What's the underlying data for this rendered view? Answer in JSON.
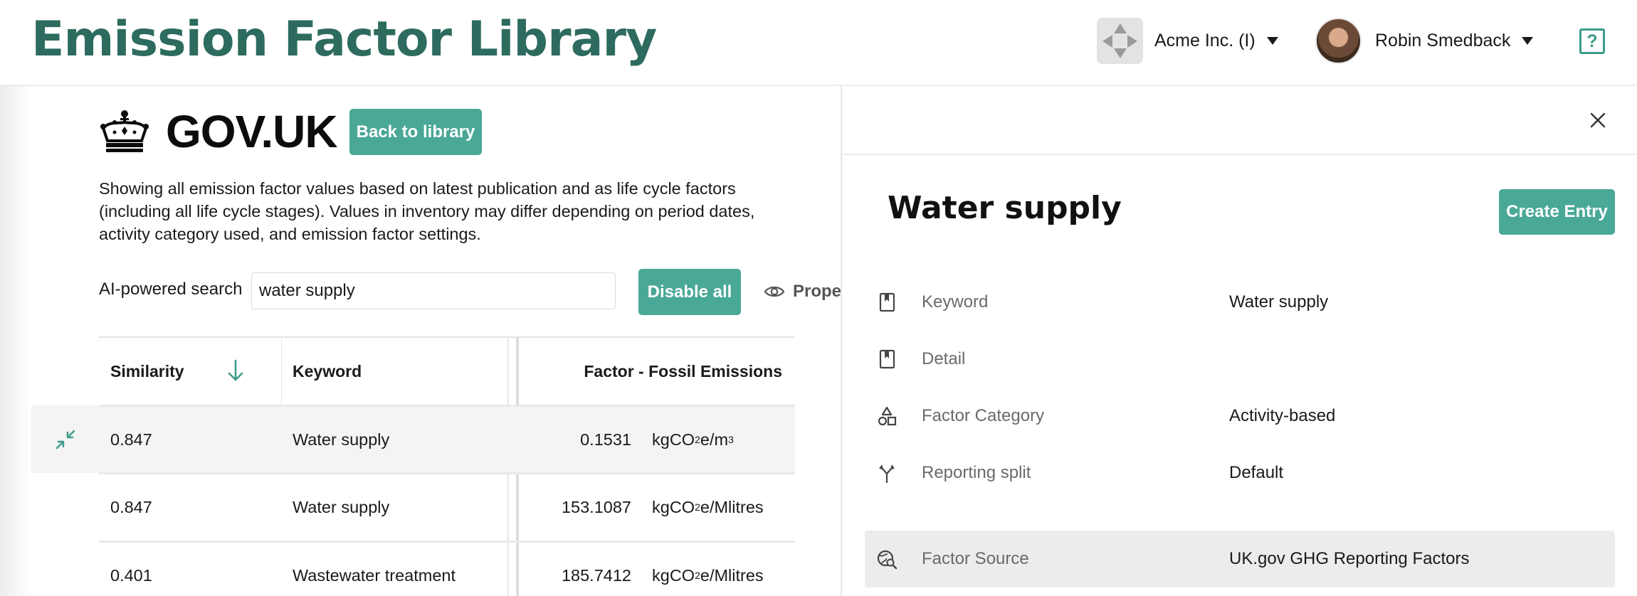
{
  "header": {
    "app_title": "Emission Factor Library",
    "org_name": "Acme Inc. (I)",
    "user_name": "Robin Smedback",
    "help_label": "?"
  },
  "library": {
    "source_title": "GOV.UK",
    "back_label": "Back to library",
    "description": "Showing all emission factor values based on latest publication and as life cycle factors (including all life cycle stages). Values in inventory may differ depending on period dates, activity category used, and emission factor settings.",
    "search_label": "AI-powered search",
    "search_value": "water supply",
    "disable_label": "Disable all",
    "properties_label": "Proper"
  },
  "table": {
    "columns": [
      "Similarity",
      "Keyword",
      "Factor - Fossil Emissions"
    ],
    "rows": [
      {
        "similarity": "0.847",
        "keyword": "Water supply",
        "value": "0.1531",
        "unit_prefix": "kgCO",
        "unit_sub": "2",
        "unit_suffix": "e/m",
        "unit_sup": "3"
      },
      {
        "similarity": "0.847",
        "keyword": "Water supply",
        "value": "153.1087",
        "unit_prefix": "kgCO",
        "unit_sub": "2",
        "unit_suffix": "e/Mlitres",
        "unit_sup": ""
      },
      {
        "similarity": "0.401",
        "keyword": "Wastewater treatment",
        "value": "185.7412",
        "unit_prefix": "kgCO",
        "unit_sub": "2",
        "unit_suffix": "e/Mlitres",
        "unit_sup": ""
      }
    ]
  },
  "drawer": {
    "title": "Water supply",
    "create_label": "Create Entry",
    "properties": [
      {
        "label": "Keyword",
        "value": "Water supply",
        "icon": "bookmark-icon"
      },
      {
        "label": "Detail",
        "value": "",
        "icon": "bookmark-icon"
      },
      {
        "label": "Factor Category",
        "value": "Activity-based",
        "icon": "shapes-icon"
      },
      {
        "label": "Reporting split",
        "value": "Default",
        "icon": "split-icon"
      },
      {
        "label": "Factor Source",
        "value": "UK.gov GHG Reporting Factors",
        "icon": "source-search-icon"
      }
    ]
  },
  "colors": {
    "brand": "#2d6b5e",
    "accent": "#4aa896",
    "highlight_row": "#f4f4f4"
  }
}
